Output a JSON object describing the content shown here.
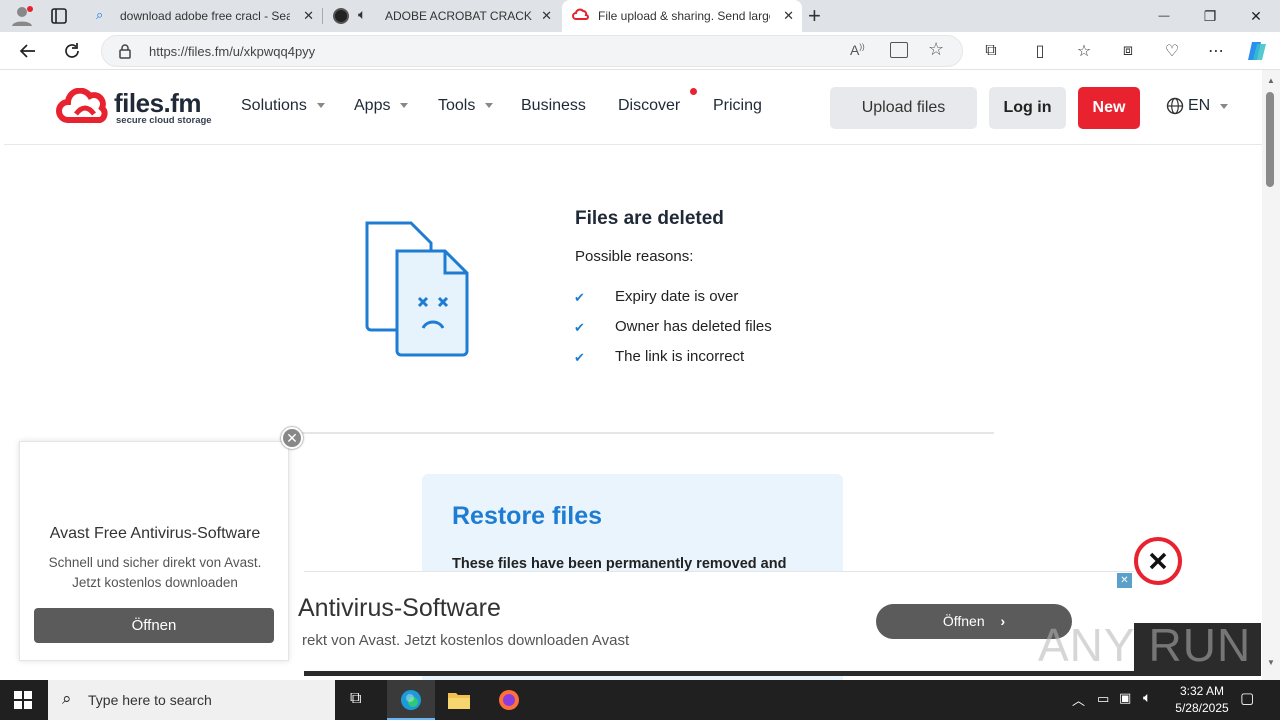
{
  "browser": {
    "tabs": [
      {
        "title": "download adobe free cracl - Sear",
        "icon": "search-icon",
        "active": false
      },
      {
        "title": "ADOBE ACROBAT CRACK | A",
        "icon": "audio-icon",
        "active": false
      },
      {
        "title": "File upload & sharing. Send large",
        "icon": "filesfm-icon",
        "active": true
      }
    ],
    "new_tab": "+",
    "url": "https://files.fm/u/xkpwqq4pyy",
    "controls": {
      "minimize": "—",
      "maximize": "❐",
      "close": "✕"
    }
  },
  "site": {
    "logo": "files.fm",
    "tagline": "secure cloud storage",
    "nav": [
      {
        "label": "Solutions",
        "dropdown": true
      },
      {
        "label": "Apps",
        "dropdown": true
      },
      {
        "label": "Tools",
        "dropdown": true
      },
      {
        "label": "Business",
        "dropdown": false
      },
      {
        "label": "Discover",
        "dropdown": false
      },
      {
        "label": "Pricing",
        "dropdown": false
      }
    ],
    "upload": "Upload files",
    "login": "Log in",
    "new": "New",
    "lang": "EN",
    "accent": "#e8232f"
  },
  "deleted": {
    "title": "Files are deleted",
    "subtitle": "Possible reasons:",
    "reasons": [
      "Expiry date is over",
      "Owner has deleted files",
      "The link is incorrect"
    ]
  },
  "restore": {
    "title": "Restore files",
    "text": "These files have been permanently removed and"
  },
  "popup_ad": {
    "title": "Avast Free Antivirus-Software",
    "line1": "Schnell und sicher direkt von Avast.",
    "line2": "Jetzt kostenlos downloaden",
    "button": "Öffnen",
    "close": "✕"
  },
  "banner_ad": {
    "title": "Antivirus-Software",
    "text": "rekt von Avast. Jetzt kostenlos downloaden Avast",
    "button": "Öffnen",
    "close": "✕"
  },
  "watermark": "ANY RUN",
  "taskbar": {
    "search": "Type here to search",
    "time": "3:32 AM",
    "date": "5/28/2025"
  }
}
